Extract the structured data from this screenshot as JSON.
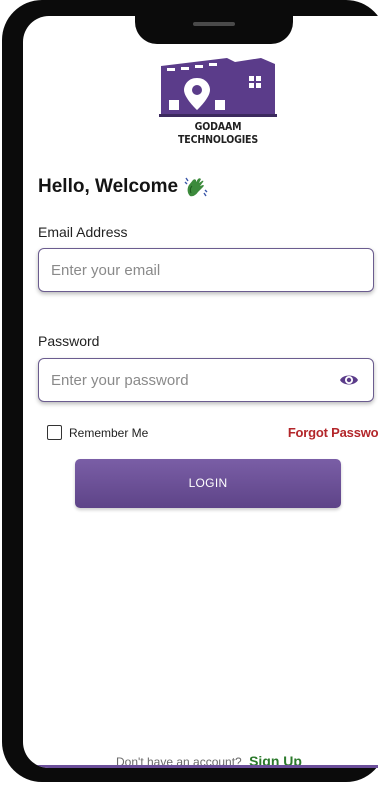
{
  "brand": {
    "company_name": "GODAAM TECHNOLOGIES",
    "logo_icon": "warehouse-location-icon",
    "primary_color": "#6b4e9a",
    "logo_color": "#5b3c8a"
  },
  "greeting": {
    "text": "Hello, Welcome",
    "icon": "waving-hand-icon"
  },
  "email_field": {
    "label": "Email Address",
    "placeholder": "Enter your email",
    "value": ""
  },
  "password_field": {
    "label": "Password",
    "placeholder": "Enter your password",
    "value": "",
    "toggle_icon": "eye-icon"
  },
  "remember_me": {
    "label": "Remember Me",
    "checked": false
  },
  "forgot_password": {
    "label": "Forgot Password",
    "color": "#b3262a"
  },
  "login_button": {
    "label": "LOGIN"
  },
  "signup": {
    "prompt": "Don't have an account?",
    "link_label": "Sign Up",
    "link_color": "#2c7a2c"
  }
}
